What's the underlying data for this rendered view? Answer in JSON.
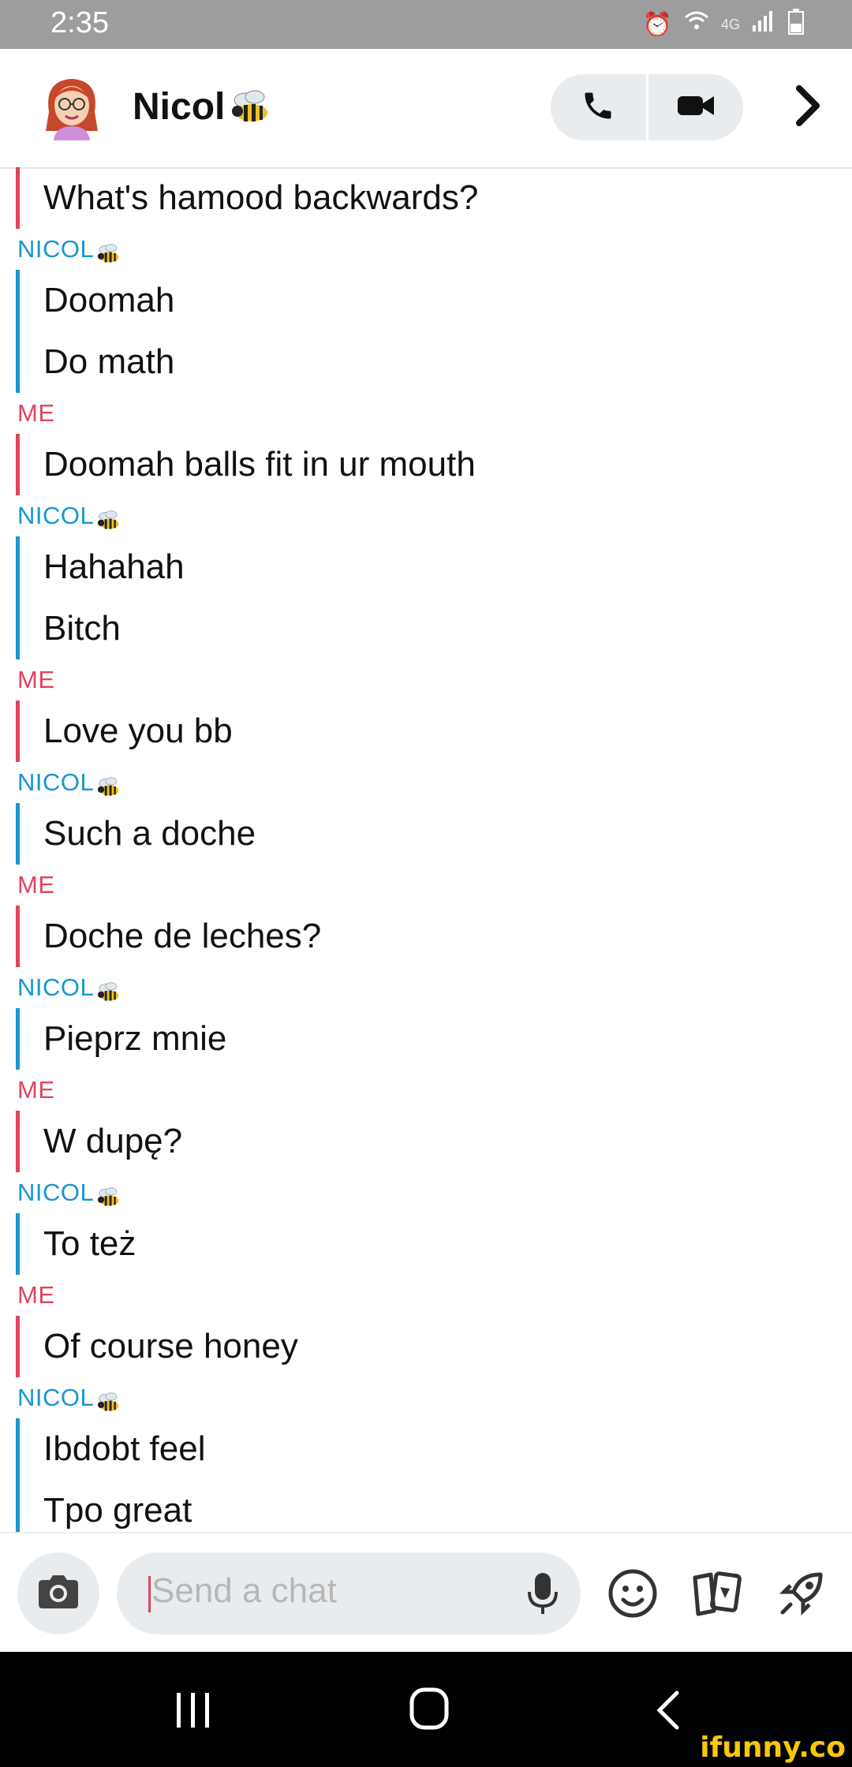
{
  "status_bar": {
    "time": "2:35",
    "network": "4G"
  },
  "header": {
    "contact_name": "Nicol"
  },
  "chat": {
    "messages": [
      {
        "sender": "",
        "side": "me",
        "lines": [
          "What's hamood backwards?"
        ]
      },
      {
        "sender": "NICOL",
        "side": "them",
        "lines": [
          "Doomah",
          "Do math"
        ]
      },
      {
        "sender": "ME",
        "side": "me",
        "lines": [
          "Doomah balls fit in ur mouth"
        ]
      },
      {
        "sender": "NICOL",
        "side": "them",
        "lines": [
          "Hahahah",
          "Bitch"
        ]
      },
      {
        "sender": "ME",
        "side": "me",
        "lines": [
          "Love you bb"
        ]
      },
      {
        "sender": "NICOL",
        "side": "them",
        "lines": [
          "Such a doche"
        ]
      },
      {
        "sender": "ME",
        "side": "me",
        "lines": [
          "Doche de leches?"
        ]
      },
      {
        "sender": "NICOL",
        "side": "them",
        "lines": [
          "Pieprz mnie"
        ]
      },
      {
        "sender": "ME",
        "side": "me",
        "lines": [
          "W dupę?"
        ]
      },
      {
        "sender": "NICOL",
        "side": "them",
        "lines": [
          "To też"
        ]
      },
      {
        "sender": "ME",
        "side": "me",
        "lines": [
          "Of course honey"
        ]
      },
      {
        "sender": "NICOL",
        "side": "them",
        "lines": [
          "Ibdobt feel",
          "Tpo great"
        ]
      }
    ]
  },
  "input": {
    "placeholder": "Send a chat"
  },
  "watermark": "ifunny.co",
  "colors": {
    "me": "#e0455e",
    "them": "#1a96d1"
  },
  "icons": [
    "phone-icon",
    "video-icon",
    "chevron-right-icon",
    "camera-icon",
    "mic-icon",
    "smiley-icon",
    "cards-icon",
    "rocket-icon"
  ]
}
